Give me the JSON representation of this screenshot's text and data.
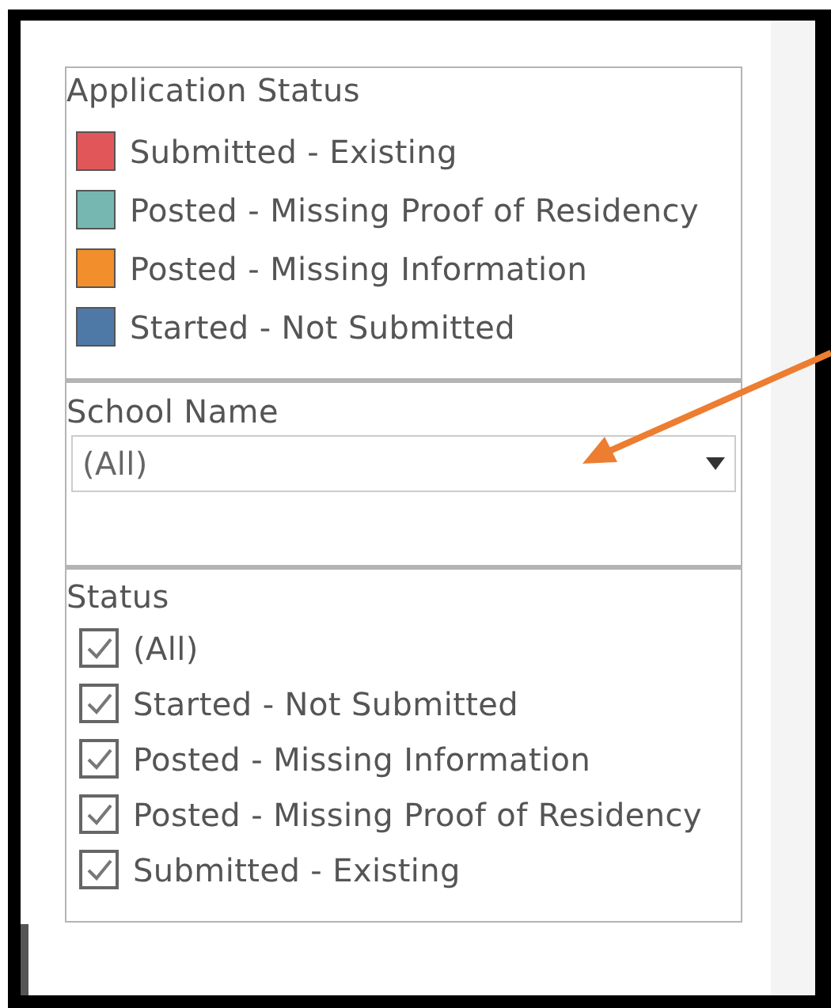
{
  "legend": {
    "title": "Application Status",
    "items": [
      {
        "label": "Submitted - Existing",
        "color": "#e15759"
      },
      {
        "label": "Posted - Missing Proof of Residency",
        "color": "#76b7b2"
      },
      {
        "label": "Posted - Missing Information",
        "color": "#f28e2b"
      },
      {
        "label": "Started - Not Submitted",
        "color": "#4e79a7"
      }
    ]
  },
  "school_filter": {
    "title": "School Name",
    "value": "(All)"
  },
  "status_filter": {
    "title": "Status",
    "items": [
      {
        "label": "(All)",
        "checked": true
      },
      {
        "label": "Started - Not Submitted",
        "checked": true
      },
      {
        "label": "Posted - Missing Information",
        "checked": true
      },
      {
        "label": "Posted - Missing Proof of Residency",
        "checked": true
      },
      {
        "label": "Submitted - Existing",
        "checked": true
      }
    ]
  }
}
